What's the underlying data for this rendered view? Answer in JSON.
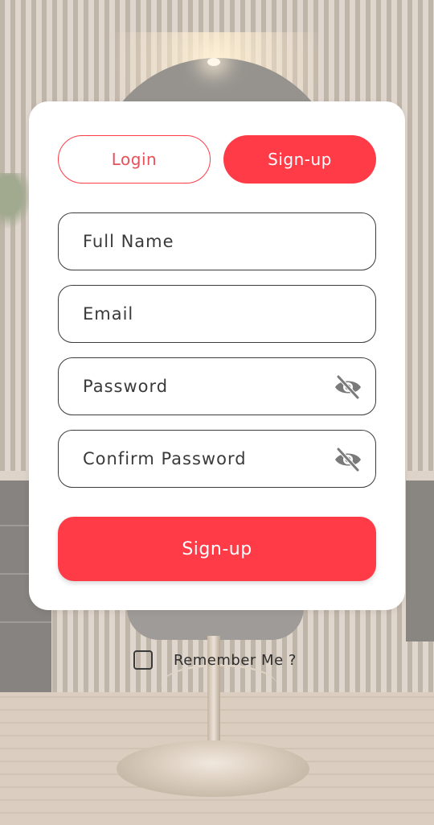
{
  "auth_tabs": {
    "login_label": "Login",
    "signup_label": "Sign-up",
    "active_tab": "Sign-up"
  },
  "form": {
    "full_name": {
      "placeholder": "Full Name",
      "value": ""
    },
    "email": {
      "placeholder": "Email",
      "value": ""
    },
    "password": {
      "placeholder": "Password",
      "value": "",
      "toggle_icon": "eye-off-icon"
    },
    "confirm_password": {
      "placeholder": "Confirm Password",
      "value": "",
      "toggle_icon": "eye-off-icon"
    },
    "submit_label": "Sign-up"
  },
  "remember": {
    "label": "Remember Me ?",
    "checked": false
  },
  "colors": {
    "accent": "#ff3b47",
    "card_background": "#ffffff",
    "field_border": "#3b3b3b"
  }
}
